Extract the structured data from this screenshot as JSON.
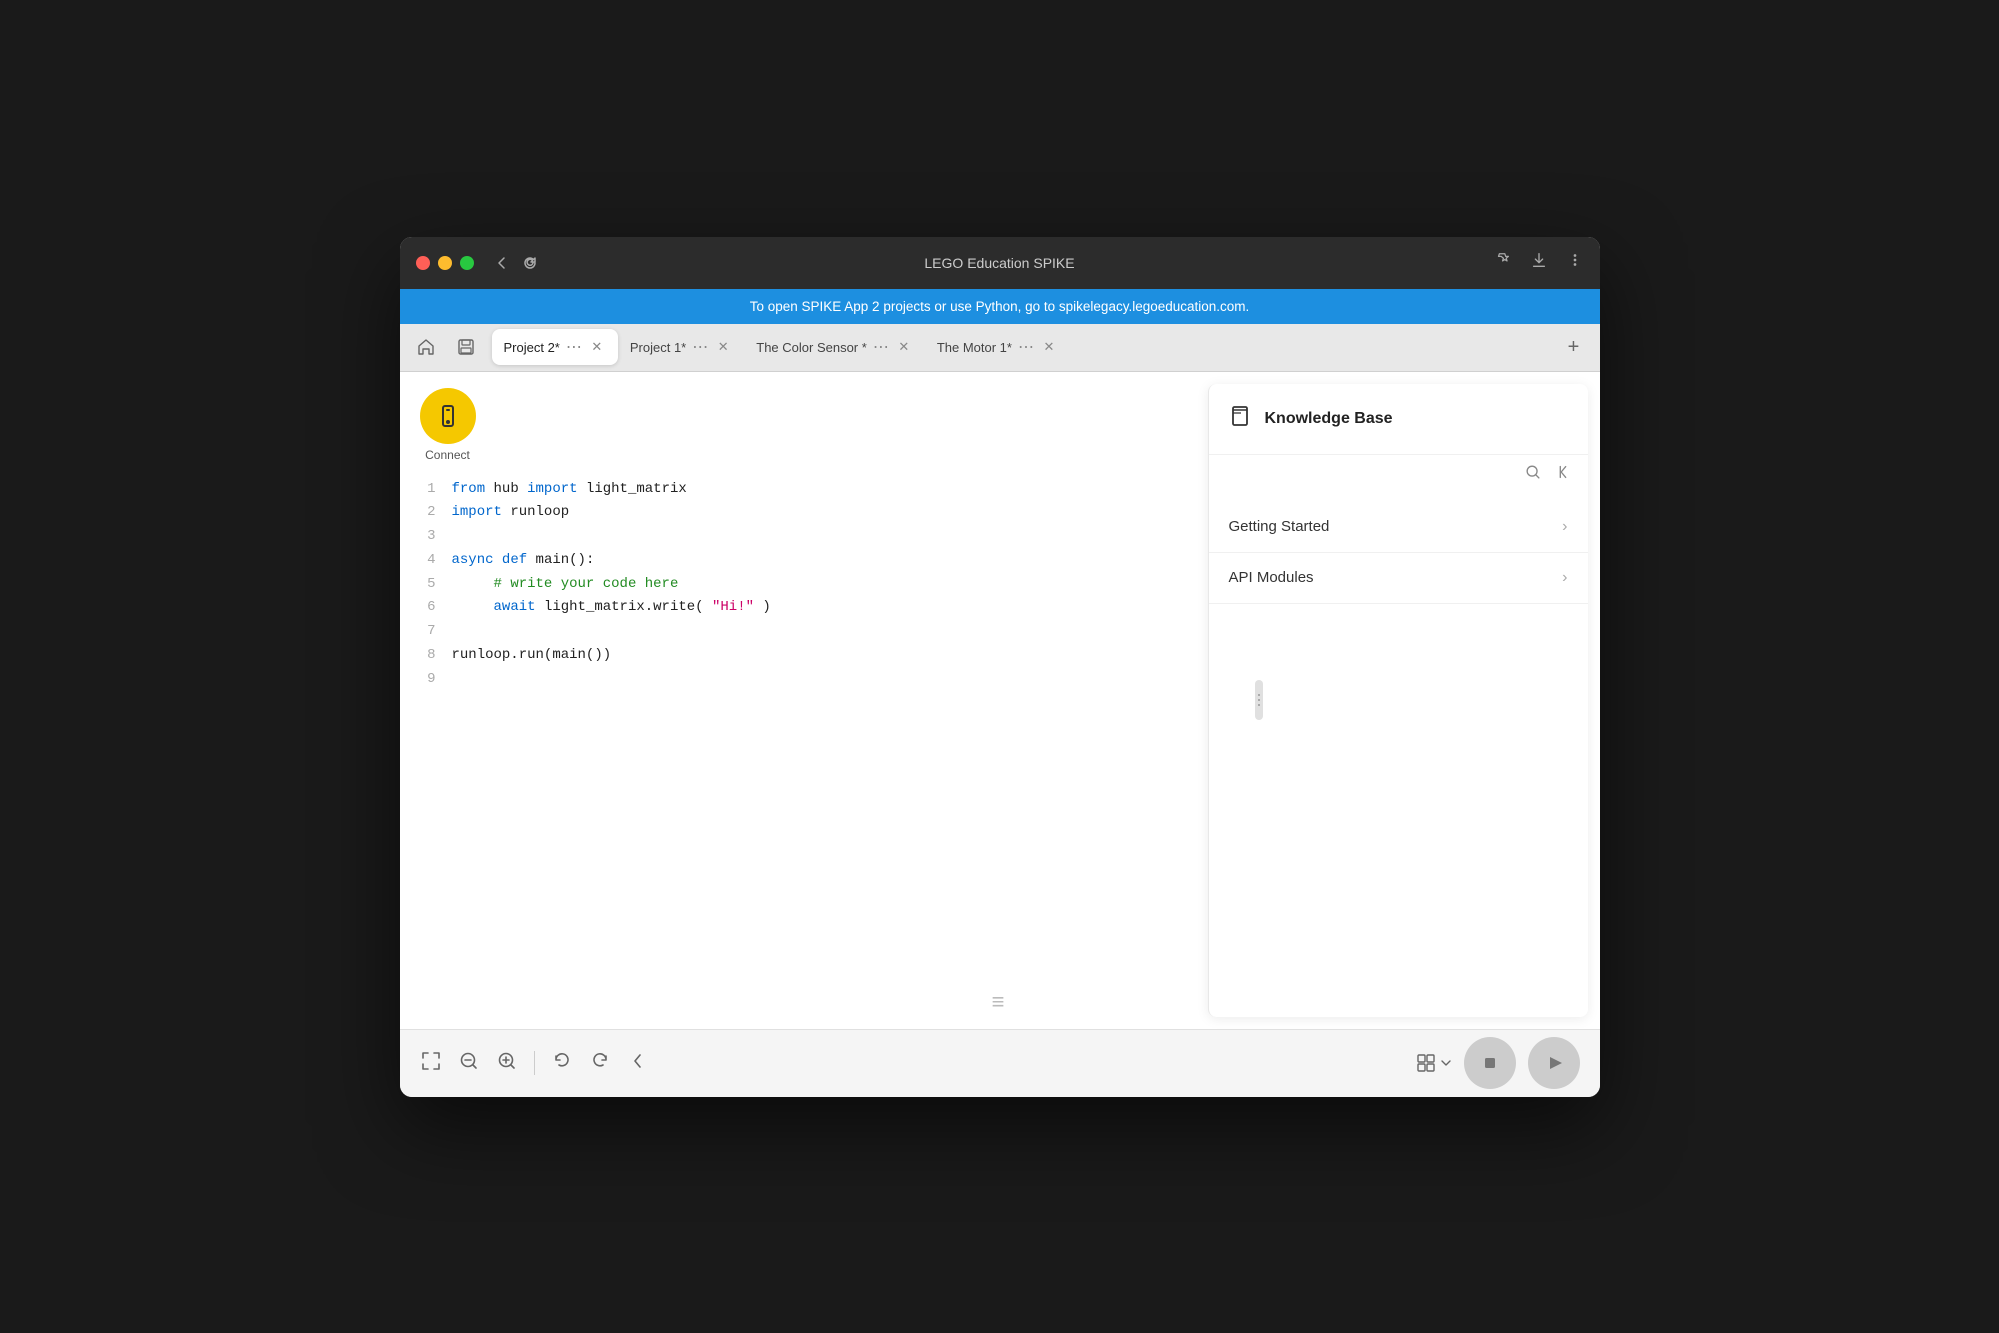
{
  "window": {
    "title": "LEGO Education SPIKE"
  },
  "banner": {
    "text": "To open SPIKE App 2 projects or use Python, go to spikelegacy.legoeducation.com."
  },
  "tabs": [
    {
      "label": "Project 2*",
      "active": true
    },
    {
      "label": "Project 1*",
      "active": false
    },
    {
      "label": "The Color Sensor *",
      "active": false
    },
    {
      "label": "The Motor 1*",
      "active": false
    }
  ],
  "connect": {
    "label": "Connect"
  },
  "code": {
    "lines": [
      {
        "num": "1",
        "content": "from hub import light_matrix"
      },
      {
        "num": "2",
        "content": "import runloop"
      },
      {
        "num": "3",
        "content": ""
      },
      {
        "num": "4",
        "content": "async def main():"
      },
      {
        "num": "5",
        "content": "    # write your code here"
      },
      {
        "num": "6",
        "content": "    await light_matrix.write(\"Hi!\")"
      },
      {
        "num": "7",
        "content": ""
      },
      {
        "num": "8",
        "content": "runloop.run(main())"
      },
      {
        "num": "9",
        "content": ""
      }
    ]
  },
  "knowledge_base": {
    "title": "Knowledge Base",
    "items": [
      {
        "label": "Getting Started"
      },
      {
        "label": "API Modules"
      }
    ]
  },
  "bottom_bar": {
    "fullscreen_label": "⤢",
    "zoom_out_label": "−",
    "zoom_in_label": "+",
    "undo_label": "↺",
    "redo_label": "↻",
    "collapse_label": "‹"
  }
}
